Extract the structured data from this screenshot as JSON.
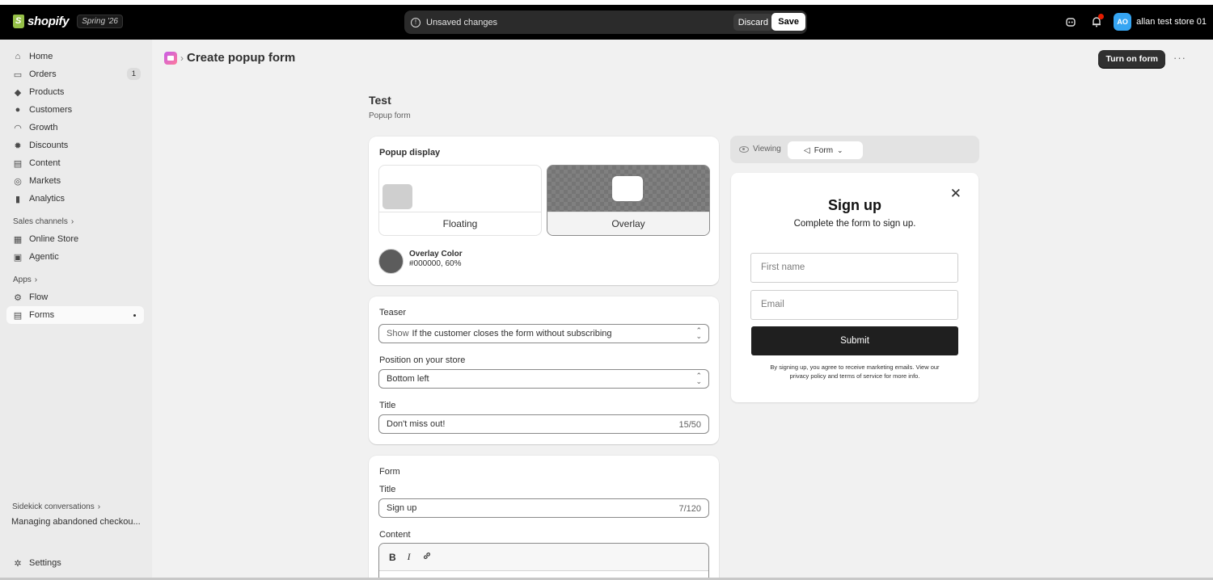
{
  "topbar": {
    "brand": "shopify",
    "edition": "Spring '26",
    "unsaved_text": "Unsaved changes",
    "discard_label": "Discard",
    "save_label": "Save",
    "avatar_initials": "AO",
    "store_name": "allan test store 01"
  },
  "sidebar": {
    "items": [
      {
        "label": "Home",
        "icon": "home-icon"
      },
      {
        "label": "Orders",
        "icon": "inbox-icon",
        "badge": "1"
      },
      {
        "label": "Products",
        "icon": "tag-icon"
      },
      {
        "label": "Customers",
        "icon": "person-icon"
      },
      {
        "label": "Growth",
        "icon": "gauge-icon"
      },
      {
        "label": "Discounts",
        "icon": "discount-icon"
      },
      {
        "label": "Content",
        "icon": "content-icon"
      },
      {
        "label": "Markets",
        "icon": "globe-icon"
      },
      {
        "label": "Analytics",
        "icon": "bar-chart-icon"
      }
    ],
    "sales_channels_label": "Sales channels",
    "channels": [
      {
        "label": "Online Store",
        "icon": "store-icon"
      },
      {
        "label": "Agentic",
        "icon": "agentic-icon"
      }
    ],
    "apps_label": "Apps",
    "apps": [
      {
        "label": "Flow",
        "icon": "flow-icon"
      },
      {
        "label": "Forms",
        "icon": "forms-icon"
      }
    ],
    "sidekick_label": "Sidekick conversations",
    "sidekick_item": "Managing abandoned checkou...",
    "settings_label": "Settings"
  },
  "page": {
    "breadcrumb_title": "Create popup form",
    "turn_on_label": "Turn on form",
    "more_label": "···",
    "form_name": "Test",
    "form_type": "Popup form"
  },
  "popup_display": {
    "heading": "Popup display",
    "option_floating": "Floating",
    "option_overlay": "Overlay",
    "selected": "Overlay",
    "overlay_color_label": "Overlay Color",
    "overlay_color_value": "#000000, 60%",
    "overlay_color_hex": "#000000"
  },
  "teaser": {
    "heading": "Teaser",
    "show_prefix": "Show",
    "show_value": "If the customer closes the form without subscribing",
    "position_label": "Position on your store",
    "position_value": "Bottom left",
    "title_label": "Title",
    "title_value": "Don't miss out!",
    "title_counter": "15/50"
  },
  "form_section": {
    "heading": "Form",
    "title_label": "Title",
    "title_value": "Sign up",
    "title_counter": "7/120",
    "content_label": "Content",
    "toolbar": {
      "bold": "B",
      "italic": "I"
    }
  },
  "preview": {
    "viewing_label": "Viewing",
    "view_value": "Form",
    "title": "Sign up",
    "subtitle": "Complete the form to sign up.",
    "first_name_placeholder": "First name",
    "email_placeholder": "Email",
    "submit_label": "Submit",
    "legal_text": "By signing up, you agree to receive marketing emails. View our privacy policy and terms of service for more info."
  }
}
